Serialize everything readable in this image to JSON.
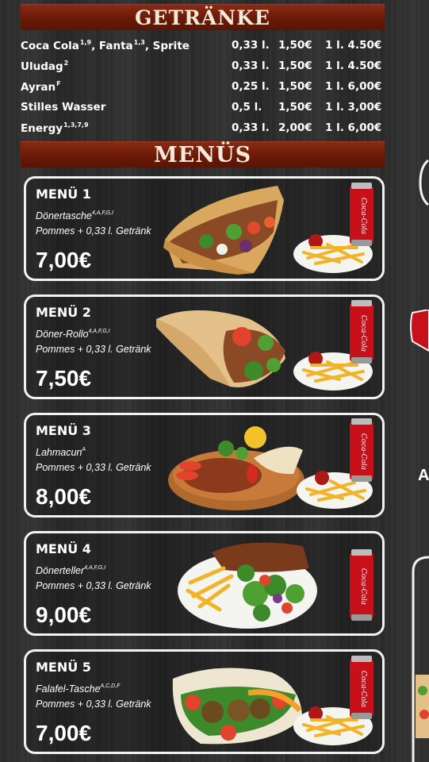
{
  "sections": {
    "drinks_title": "GETRÄNKE",
    "menus_title": "MENÜS"
  },
  "drinks": [
    {
      "name": "Coca Cola",
      "sup1": "1,9",
      "name2": ", Fanta",
      "sup2": "1,3",
      "name3": ", Sprite",
      "size": "0,33 l.",
      "price": "1,50€",
      "big": "1 l. 4.50€"
    },
    {
      "name": "Uludag",
      "sup1": "2",
      "name2": "",
      "sup2": "",
      "name3": "",
      "size": "0,33 l.",
      "price": "1,50€",
      "big": "1 l. 4.50€"
    },
    {
      "name": "Ayran",
      "sup1": "F",
      "name2": "",
      "sup2": "",
      "name3": "",
      "size": "0,25 l.",
      "price": "1,50€",
      "big": "1 l. 6,00€"
    },
    {
      "name": "Stilles Wasser",
      "sup1": "",
      "name2": "",
      "sup2": "",
      "name3": "",
      "size": "0,5 l.",
      "price": "1,50€",
      "big": "1 l. 3,00€"
    },
    {
      "name": "Energy",
      "sup1": "1,3,7,9",
      "name2": "",
      "sup2": "",
      "name3": "",
      "size": "0,33 l.",
      "price": "2,00€",
      "big": "1 l. 6,00€"
    }
  ],
  "menus": [
    {
      "title": "MENÜ 1",
      "dish": "Dönertasche",
      "dish_sup": "4,A,F,G,I",
      "extras": "Pommes + 0,33 l. Getränk",
      "price": "7,00€",
      "food_icon": "doener-tasche-image"
    },
    {
      "title": "MENÜ 2",
      "dish": "Döner-Rollo",
      "dish_sup": "4,A,F,G,I",
      "extras": "Pommes + 0,33 l. Getränk",
      "price": "7,50€",
      "food_icon": "doener-rollo-image"
    },
    {
      "title": "MENÜ 3",
      "dish": "Lahmacun",
      "dish_sup": "A",
      "extras": "Pommes + 0,33 l. Getränk",
      "price": "8,00€",
      "food_icon": "lahmacun-image"
    },
    {
      "title": "MENÜ 4",
      "dish": "Dönerteller",
      "dish_sup": "4,A,F,G,I",
      "extras": "Pommes + 0,33 l. Getränk",
      "price": "9,00€",
      "food_icon": "doener-teller-image"
    },
    {
      "title": "MENÜ 5",
      "dish": "Falafel-Tasche",
      "dish_sup": "A,C,D,F",
      "extras": "Pommes + 0,33 l. Getränk",
      "price": "7,00€",
      "food_icon": "falafel-tasche-image"
    }
  ],
  "can_label": "Coca-Cola",
  "side_letter": "A",
  "colors": {
    "banner": "#6a1a08",
    "banner_text": "#f3ead8",
    "card_border": "#f2f2f2",
    "can_red": "#c8101a"
  }
}
